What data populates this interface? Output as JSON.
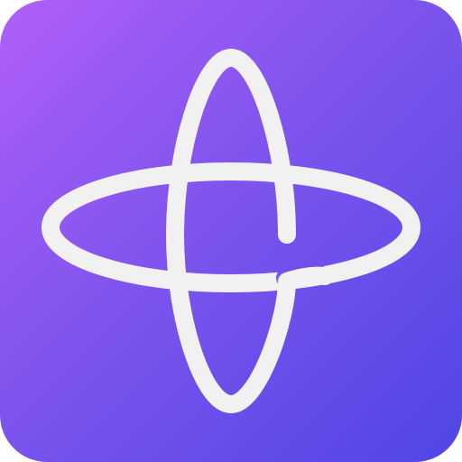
{
  "app_icon": {
    "icon_name": "orbit-logo-icon",
    "gradient_start": "#b05ff8",
    "gradient_mid": "#7f54ee",
    "gradient_end": "#4f46e5",
    "stroke_color": "#f1f1f1"
  }
}
